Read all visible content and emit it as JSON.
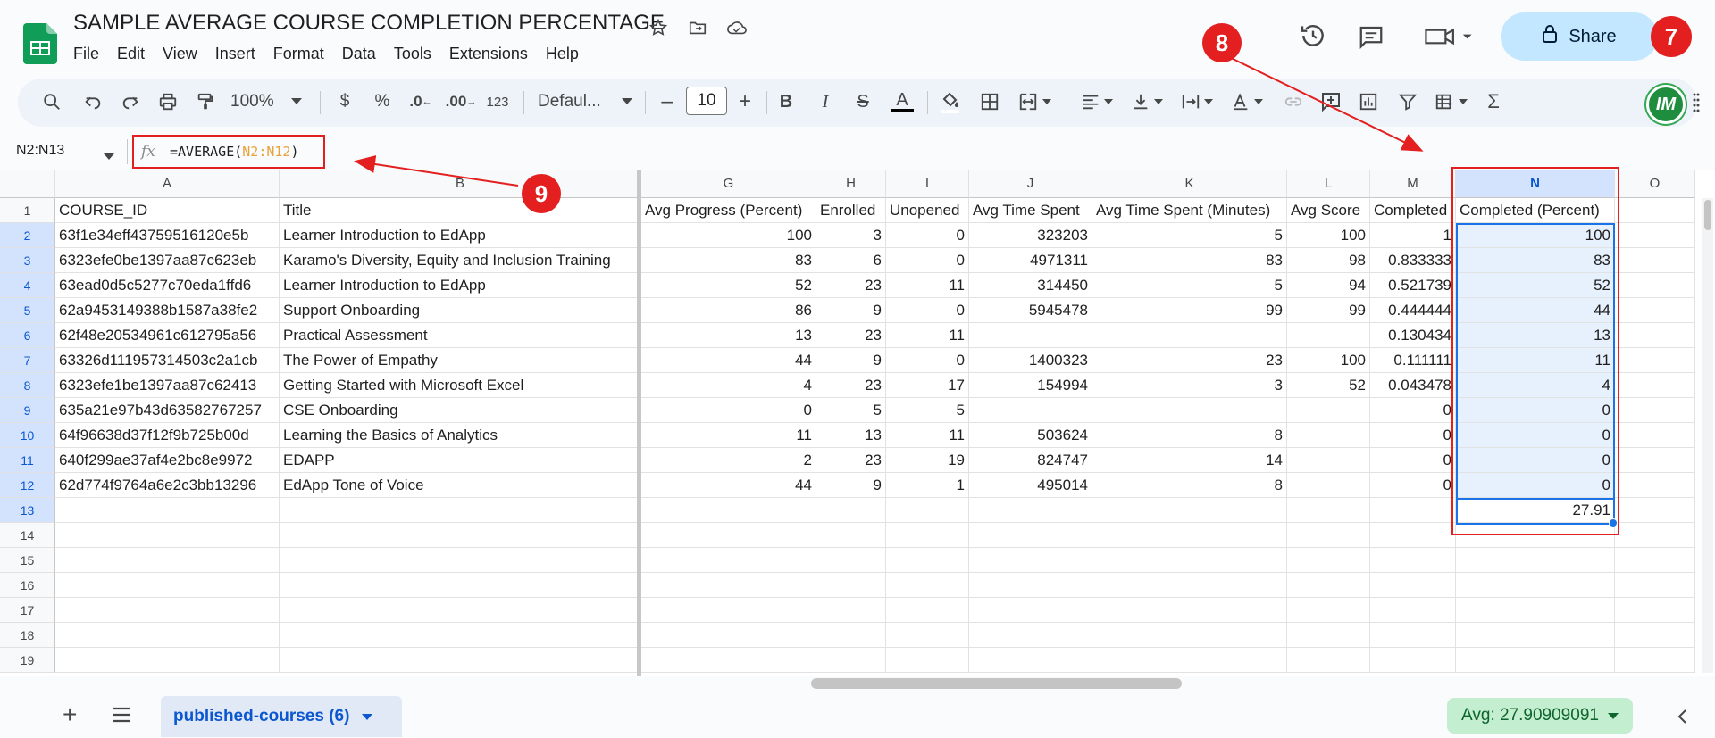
{
  "doc": {
    "title": "SAMPLE AVERAGE COURSE COMPLETION PERCENTAGE"
  },
  "menu": [
    "File",
    "Edit",
    "View",
    "Insert",
    "Format",
    "Data",
    "Tools",
    "Extensions",
    "Help"
  ],
  "share_label": "Share",
  "badges": {
    "seven": "7",
    "eight": "8",
    "nine": "9"
  },
  "toolbar": {
    "zoom": "100%",
    "currency": "$",
    "percent": "%",
    "dec_decrease": ".0",
    "dec_increase": ".00",
    "number_format": "123",
    "font": "Defaul...",
    "font_size": "10",
    "bold": "B",
    "italic": "I",
    "strike": "S",
    "text_color": "A",
    "sum": "Σ"
  },
  "avatar_initials": "IM",
  "formula_bar": {
    "name_box": "N2:N13",
    "fx": "fx",
    "formula_prefix": "=AVERAGE(",
    "formula_ref": "N2:N12",
    "formula_suffix": ")"
  },
  "columns": [
    {
      "id": "A",
      "header": "COURSE_ID"
    },
    {
      "id": "B",
      "header": "Title"
    },
    {
      "id": "G",
      "header": "Avg Progress (Percent)"
    },
    {
      "id": "H",
      "header": "Enrolled"
    },
    {
      "id": "I",
      "header": "Unopened"
    },
    {
      "id": "J",
      "header": "Avg Time Spent"
    },
    {
      "id": "K",
      "header": "Avg Time Spent (Minutes)"
    },
    {
      "id": "L",
      "header": "Avg Score"
    },
    {
      "id": "M",
      "header": "Completed"
    },
    {
      "id": "N",
      "header": "Completed (Percent)"
    },
    {
      "id": "O",
      "header": ""
    }
  ],
  "row_numbers": [
    "1",
    "2",
    "3",
    "4",
    "5",
    "6",
    "7",
    "8",
    "9",
    "10",
    "11",
    "12",
    "13",
    "14",
    "15",
    "16",
    "17",
    "18",
    "19"
  ],
  "rows": [
    [
      "63f1e34eff43759516120e5b",
      "Learner Introduction to EdApp",
      "100",
      "3",
      "0",
      "323203",
      "5",
      "100",
      "1",
      "100",
      ""
    ],
    [
      "6323efe0be1397aa87c623eb",
      "Karamo's Diversity, Equity and Inclusion Training",
      "83",
      "6",
      "0",
      "4971311",
      "83",
      "98",
      "0.833333",
      "83",
      ""
    ],
    [
      "63ead0d5c5277c70eda1ffd6",
      "Learner Introduction to EdApp",
      "52",
      "23",
      "11",
      "314450",
      "5",
      "94",
      "0.521739",
      "52",
      ""
    ],
    [
      "62a9453149388b1587a38fe2",
      "Support Onboarding",
      "86",
      "9",
      "0",
      "5945478",
      "99",
      "99",
      "0.444444",
      "44",
      ""
    ],
    [
      "62f48e20534961c612795a56",
      "Practical Assessment",
      "13",
      "23",
      "11",
      "",
      "",
      "",
      "0.130434",
      "13",
      ""
    ],
    [
      "63326d111957314503c2a1cb",
      "The Power of Empathy",
      "44",
      "9",
      "0",
      "1400323",
      "23",
      "100",
      "0.111111",
      "11",
      ""
    ],
    [
      "6323efe1be1397aa87c62413",
      "Getting Started with Microsoft Excel",
      "4",
      "23",
      "17",
      "154994",
      "3",
      "52",
      "0.043478",
      "4",
      ""
    ],
    [
      "635a21e97b43d63582767257",
      "CSE Onboarding",
      "0",
      "5",
      "5",
      "",
      "",
      "",
      "0",
      "0",
      ""
    ],
    [
      "64f96638d37f12f9b725b00d",
      "Learning the Basics of Analytics",
      "11",
      "13",
      "11",
      "503624",
      "8",
      "",
      "0",
      "0",
      ""
    ],
    [
      "640f299ae37af4e2bc8e9972",
      "EDAPP",
      "2",
      "23",
      "19",
      "824747",
      "14",
      "",
      "0",
      "0",
      ""
    ],
    [
      "62d774f9764a6e2c3bb13296",
      "EdApp Tone of Voice",
      "44",
      "9",
      "1",
      "495014",
      "8",
      "",
      "0",
      "0",
      ""
    ],
    [
      "",
      "",
      "",
      "",
      "",
      "",
      "",
      "",
      "",
      "27.91",
      ""
    ]
  ],
  "sheet_tab": {
    "label": "published-courses (6)"
  },
  "status": {
    "avg": "Avg: 27.90909091"
  }
}
